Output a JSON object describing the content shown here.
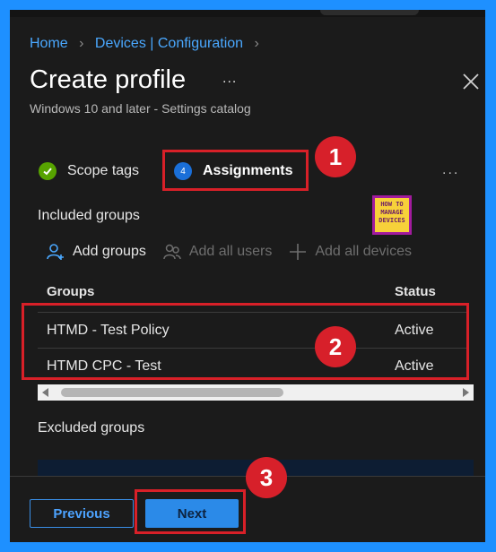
{
  "breadcrumb": {
    "items": [
      "Home",
      "Devices | Configuration"
    ]
  },
  "header": {
    "title": "Create profile",
    "more_label": "...",
    "subtitle": "Windows 10 and later - Settings catalog"
  },
  "steps": [
    {
      "label": "Scope tags",
      "state": "completed"
    },
    {
      "label": "Assignments",
      "number": "4",
      "state": "current"
    }
  ],
  "steps_more": "...",
  "included": {
    "heading": "Included groups",
    "actions": [
      {
        "label": "Add groups",
        "icon": "add-user-icon",
        "enabled": true
      },
      {
        "label": "Add all users",
        "icon": "users-icon",
        "enabled": false
      },
      {
        "label": "Add all devices",
        "icon": "plus-icon",
        "enabled": false
      }
    ],
    "columns": [
      "Groups",
      "Status"
    ],
    "rows": [
      {
        "group": "HTMD - Test Policy",
        "status": "Active"
      },
      {
        "group": "HTMD CPC - Test",
        "status": "Active"
      }
    ]
  },
  "excluded": {
    "heading": "Excluded groups"
  },
  "footer": {
    "previous_label": "Previous",
    "next_label": "Next"
  },
  "logo": {
    "text": [
      "HOW TO",
      "MANAGE",
      "DEVICES"
    ]
  },
  "callouts": [
    "1",
    "2",
    "3"
  ],
  "colors": {
    "accent": "#2b8ae8",
    "highlight": "#d82028",
    "link": "#4aa8ff",
    "success": "#57a300"
  }
}
